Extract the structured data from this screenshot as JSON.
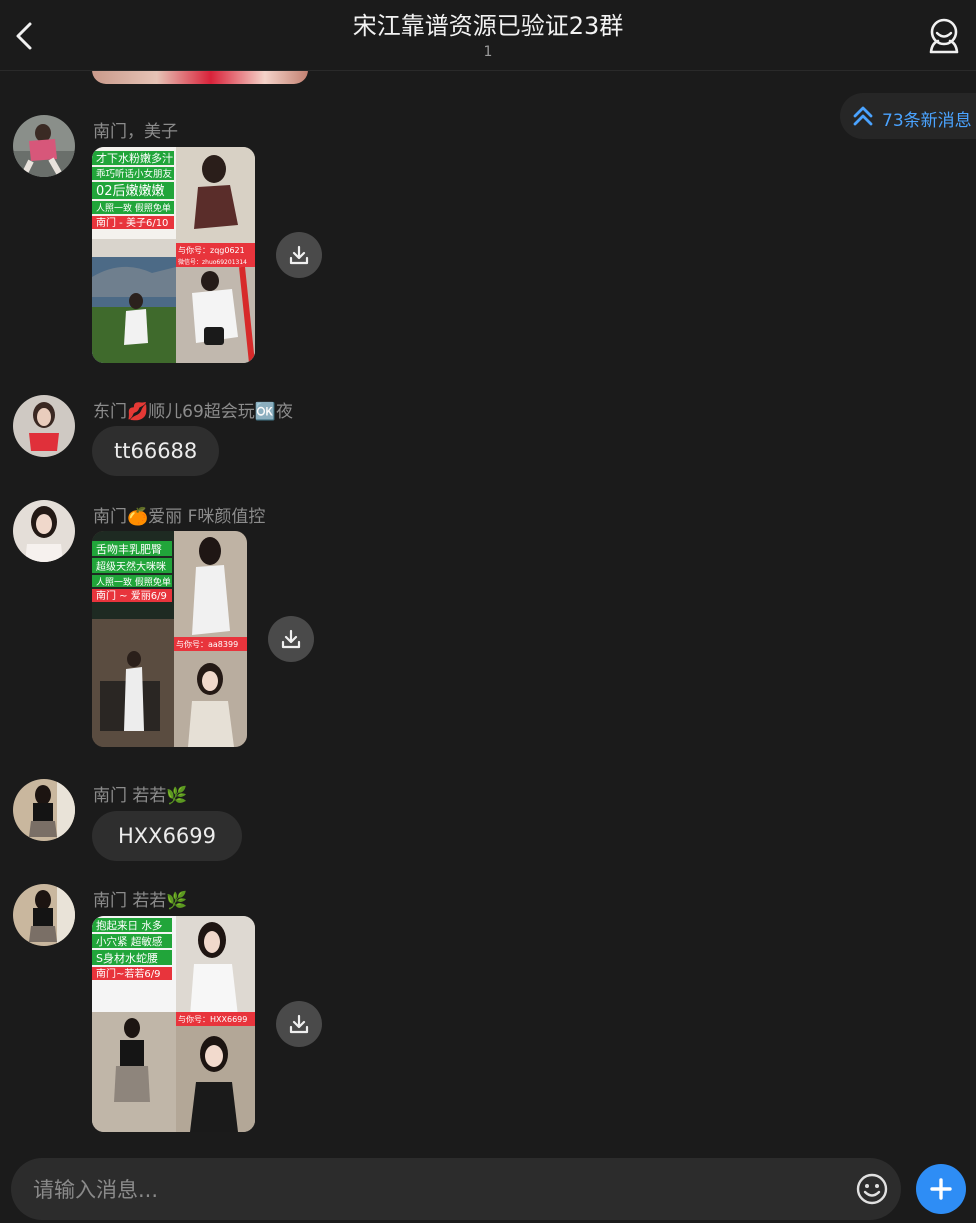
{
  "header": {
    "title": "宋江靠谱资源已验证23群",
    "subtitle": "1"
  },
  "new_messages": {
    "label": "73条新消息"
  },
  "messages": [
    {
      "sender": "南门，美子",
      "poster": {
        "lines": [
          "才下水粉嫩多汁",
          "乖巧听话小女朋友",
          "02后嫩嫩嫩",
          "人照一致 假照免单",
          "南门 - 美子6/10"
        ],
        "contact": "与你号：zqg0621",
        "contact2": "微信号：zhuo69201314"
      }
    },
    {
      "sender": "东门💋顺儿69超会玩🆗夜",
      "text": "tt66688"
    },
    {
      "sender": "南门🍊爱丽 F咪颜值控",
      "poster": {
        "lines": [
          "舌吻丰乳肥臀",
          "超级天然大咪咪",
          "人照一致 假照免单",
          "南门 ~ 爱丽6/9"
        ],
        "contact": "与你号：aa8399"
      }
    },
    {
      "sender": "南门 若若🌿",
      "text": "HXX6699"
    },
    {
      "sender": "南门 若若🌿",
      "poster": {
        "lines": [
          "抱起来日 水多",
          "小穴紧 超敏感",
          "S身材水蛇腰",
          "南门~若若6/9"
        ],
        "contact": "与你号：HXX6699"
      }
    }
  ],
  "input": {
    "placeholder": "请输入消息..."
  },
  "colors": {
    "accent": "#2e8df5",
    "link": "#4aa3ff",
    "poster_green": "#21a53a",
    "poster_red": "#e8343c"
  }
}
